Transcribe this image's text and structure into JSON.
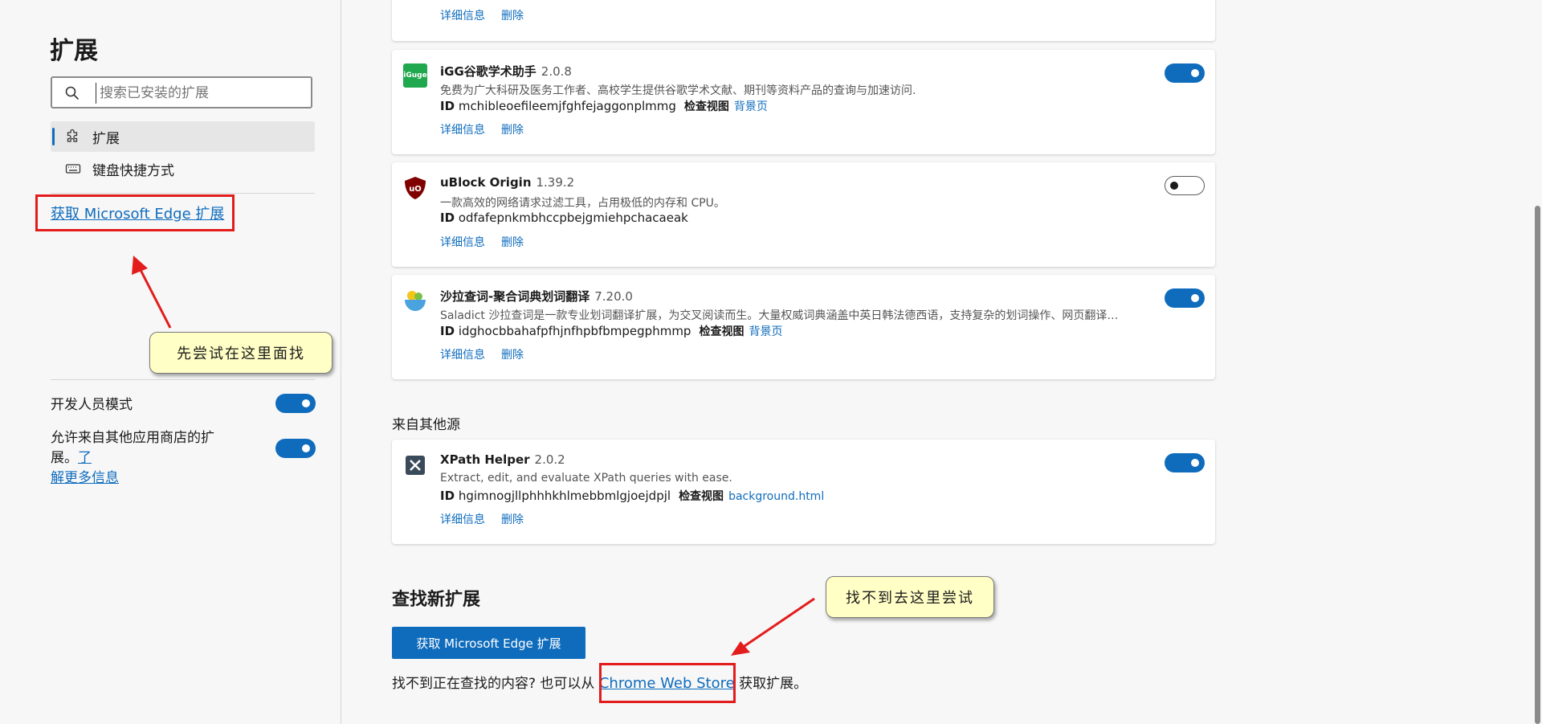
{
  "sidebar": {
    "title": "扩展",
    "search_placeholder": "搜索已安装的扩展",
    "nav": [
      {
        "label": "扩展",
        "icon": "puzzle-icon"
      },
      {
        "label": "键盘快捷方式",
        "icon": "keyboard-icon"
      }
    ],
    "edge_link": "获取 Microsoft Edge 扩展",
    "tip": "先尝试在这里面找",
    "dev_mode_label": "开发人员模式",
    "dev_mode_on": true,
    "allow_other_label": "允许来自其他应用商店的扩展。",
    "learn_more_1": "了",
    "learn_more_2": "解更多信息",
    "allow_other_on": true
  },
  "extensions": [
    {
      "actions": {
        "details": "详细信息",
        "remove": "删除"
      }
    },
    {
      "name": "iGG谷歌学术助手",
      "version": "2.0.8",
      "icon_text": "iGuge",
      "icon_color": "#20a84e",
      "desc": "免费为广大科研及医务工作者、高校学生提供谷歌学术文献、期刊等资料产品的查询与加速访问.",
      "id_label": "ID",
      "id": "mchibleoefileemjfghfejaggonplmmg",
      "view_label": "检查视图",
      "view_link": "背景页",
      "details": "详细信息",
      "remove": "删除",
      "enabled": true
    },
    {
      "name": "uBlock Origin",
      "version": "1.39.2",
      "icon_text": "uO",
      "icon_color": "#800000",
      "desc": "一款高效的网络请求过滤工具，占用极低的内存和 CPU。",
      "id_label": "ID",
      "id": "odfafepnkmbhccpbejgmiehpchacaeak",
      "details": "详细信息",
      "remove": "删除",
      "enabled": false
    },
    {
      "name": "沙拉查词-聚合词典划词翻译",
      "version": "7.20.0",
      "desc": "Saladict 沙拉查词是一款专业划词翻译扩展，为交叉阅读而生。大量权威词典涵盖中英日韩法德西语，支持复杂的划词操作、网页翻译…",
      "id_label": "ID",
      "id": "idghocbbahafpfhjnfhpbfbmpegphmmp",
      "view_label": "检查视图",
      "view_link": "背景页",
      "details": "详细信息",
      "remove": "删除",
      "enabled": true
    }
  ],
  "other_sources_label": "来自其他源",
  "xpath": {
    "name": "XPath Helper",
    "version": "2.0.2",
    "desc": "Extract, edit, and evaluate XPath queries with ease.",
    "id_label": "ID",
    "id": "hgimnogjllphhhkhlmebbmlgjoejdpjl",
    "view_label": "检查视图",
    "view_link": "background.html",
    "details": "详细信息",
    "remove": "删除",
    "enabled": true
  },
  "find": {
    "title": "查找新扩展",
    "button": "获取 Microsoft Edge 扩展",
    "text_before": "找不到正在查找的内容? 也可以从",
    "cws_link": "Chrome Web Store",
    "text_after": "获取扩展。",
    "tip": "找不到去这里尝试"
  },
  "colors": {
    "accent": "#0f6cbd",
    "annotation": "#e31c1c",
    "tip_bg": "#ffffc6"
  }
}
